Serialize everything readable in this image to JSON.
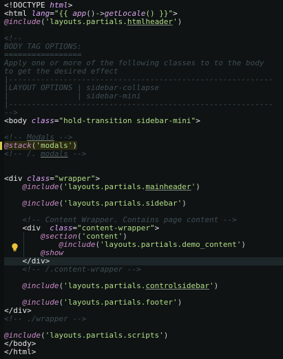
{
  "editor": {
    "language": "blade",
    "lines": [
      {
        "tokens": [
          [
            "<!DOCTYPE ",
            "tag"
          ],
          [
            "html",
            "attr"
          ],
          [
            ">",
            "tag"
          ]
        ]
      },
      {
        "tokens": [
          [
            "<",
            "tag"
          ],
          [
            "html ",
            "tag"
          ],
          [
            "lang",
            "attr"
          ],
          [
            "=",
            "eq"
          ],
          [
            "\"{{ ",
            "str"
          ],
          [
            "app",
            "fn"
          ],
          [
            "()->",
            "punc"
          ],
          [
            "getLocale",
            "fn"
          ],
          [
            "() }}\"",
            "str"
          ],
          [
            ">",
            "tag"
          ]
        ]
      },
      {
        "tokens": [
          [
            "@include",
            "kw"
          ],
          [
            "(",
            "punc"
          ],
          [
            "'layouts.partials.",
            "str"
          ],
          [
            "htmlheader",
            "str-u"
          ],
          [
            "'",
            "str"
          ],
          [
            ")",
            "punc"
          ]
        ]
      },
      {
        "tokens": []
      },
      {
        "tokens": [
          [
            "<!--",
            "cm"
          ]
        ]
      },
      {
        "tokens": [
          [
            "BODY TAG OPTIONS:",
            "cm"
          ]
        ]
      },
      {
        "tokens": [
          [
            "=================",
            "cm"
          ]
        ]
      },
      {
        "tokens": [
          [
            "Apply one or more of the following classes to to the body",
            "cm"
          ]
        ]
      },
      {
        "tokens": [
          [
            "to get the desired effect",
            "cm"
          ]
        ]
      },
      {
        "tokens": [
          [
            "|----------------------------------------------------------",
            "cm"
          ]
        ]
      },
      {
        "tokens": [
          [
            "|LAYOUT OPTIONS | sidebar-collapse",
            "cm"
          ]
        ]
      },
      {
        "tokens": [
          [
            "|               | sidebar-mini",
            "cm"
          ]
        ]
      },
      {
        "tokens": [
          [
            "|----------------------------------------------------------",
            "cm"
          ]
        ]
      },
      {
        "tokens": [
          [
            "-->",
            "cm"
          ]
        ]
      },
      {
        "tokens": [
          [
            "<",
            "tag"
          ],
          [
            "body ",
            "tag"
          ],
          [
            "class",
            "attr"
          ],
          [
            "=",
            "eq"
          ],
          [
            "\"hold-transition sidebar-mini\"",
            "str"
          ],
          [
            ">",
            "tag"
          ]
        ]
      },
      {
        "tokens": []
      },
      {
        "tokens": [
          [
            "<!-- ",
            "cm"
          ],
          [
            "Modals",
            "cm-u"
          ],
          [
            " -->",
            "cm"
          ]
        ]
      },
      {
        "tokens": [
          [
            "@stack",
            "kw"
          ],
          [
            "(",
            "punc"
          ],
          [
            "'modals'",
            "str"
          ],
          [
            ")",
            "punc"
          ]
        ]
      },
      {
        "tokens": [
          [
            "<!-- /. ",
            "cm"
          ],
          [
            "modals",
            "cm-u"
          ],
          [
            " -->",
            "cm"
          ]
        ]
      },
      {
        "tokens": []
      },
      {
        "tokens": []
      },
      {
        "tokens": [
          [
            "<",
            "tag"
          ],
          [
            "div ",
            "tag"
          ],
          [
            "class",
            "attr"
          ],
          [
            "=",
            "eq"
          ],
          [
            "\"wrapper\"",
            "str"
          ],
          [
            ">",
            "tag"
          ]
        ]
      },
      {
        "tokens": [
          [
            "    ",
            "punc"
          ],
          [
            "@include",
            "kw"
          ],
          [
            "(",
            "punc"
          ],
          [
            "'layouts.partials.",
            "str"
          ],
          [
            "mainheader",
            "str-u"
          ],
          [
            "'",
            "str"
          ],
          [
            ")",
            "punc"
          ]
        ]
      },
      {
        "tokens": []
      },
      {
        "tokens": [
          [
            "    ",
            "punc"
          ],
          [
            "@include",
            "kw"
          ],
          [
            "(",
            "punc"
          ],
          [
            "'layouts.partials.sidebar'",
            "str"
          ],
          [
            ")",
            "punc"
          ]
        ]
      },
      {
        "tokens": []
      },
      {
        "tokens": [
          [
            "    ",
            "punc"
          ],
          [
            "<!-- Content Wrapper. Contains page content -->",
            "cm"
          ]
        ]
      },
      {
        "tokens": [
          [
            "    ",
            "punc"
          ],
          [
            "<",
            "tag"
          ],
          [
            "div",
            "tag"
          ],
          [
            "  ",
            "punc"
          ],
          [
            "class",
            "attr"
          ],
          [
            "=",
            "eq"
          ],
          [
            "\"content-wrapper\"",
            "str"
          ],
          [
            ">",
            "tag"
          ]
        ]
      },
      {
        "tokens": [
          [
            "        ",
            "punc"
          ],
          [
            "@section",
            "kw"
          ],
          [
            "(",
            "punc"
          ],
          [
            "'content'",
            "str"
          ],
          [
            ")",
            "punc"
          ]
        ]
      },
      {
        "tokens": [
          [
            "            ",
            "punc"
          ],
          [
            "@include",
            "kw"
          ],
          [
            "(",
            "punc"
          ],
          [
            "'layouts.partials.demo_content'",
            "str"
          ],
          [
            ")",
            "punc"
          ]
        ]
      },
      {
        "tokens": [
          [
            "        ",
            "punc"
          ],
          [
            "@show",
            "kw"
          ]
        ]
      },
      {
        "tokens": [
          [
            "    ",
            "punc"
          ],
          [
            "</",
            "tag"
          ],
          [
            "div",
            "tag"
          ],
          [
            ">",
            "tag"
          ]
        ]
      },
      {
        "tokens": [
          [
            "    ",
            "punc"
          ],
          [
            "<!-- /.content-wrapper -->",
            "cm"
          ]
        ]
      },
      {
        "tokens": []
      },
      {
        "tokens": [
          [
            "    ",
            "punc"
          ],
          [
            "@include",
            "kw"
          ],
          [
            "(",
            "punc"
          ],
          [
            "'layouts.partials.",
            "str"
          ],
          [
            "controlsidebar",
            "str-u"
          ],
          [
            "'",
            "str"
          ],
          [
            ")",
            "punc"
          ]
        ]
      },
      {
        "tokens": []
      },
      {
        "tokens": [
          [
            "    ",
            "punc"
          ],
          [
            "@include",
            "kw"
          ],
          [
            "(",
            "punc"
          ],
          [
            "'layouts.partials.footer'",
            "str"
          ],
          [
            ")",
            "punc"
          ]
        ]
      },
      {
        "tokens": [
          [
            "</",
            "tag"
          ],
          [
            "div",
            "tag"
          ],
          [
            ">",
            "tag"
          ]
        ]
      },
      {
        "tokens": [
          [
            "<!-- ./wrapper -->",
            "cm"
          ]
        ]
      },
      {
        "tokens": []
      },
      {
        "tokens": [
          [
            "@include",
            "kw"
          ],
          [
            "(",
            "punc"
          ],
          [
            "'layouts.partials.scripts'",
            "str"
          ],
          [
            ")",
            "punc"
          ]
        ]
      },
      {
        "tokens": [
          [
            "</",
            "tag"
          ],
          [
            "body",
            "tag"
          ],
          [
            ">",
            "tag"
          ]
        ]
      },
      {
        "tokens": [
          [
            "</",
            "tag"
          ],
          [
            "html",
            "tag"
          ],
          [
            ">",
            "tag"
          ]
        ]
      }
    ],
    "active_line": 31,
    "highlighted_line": 17
  },
  "icons": {
    "lightbulb": "lightbulb-icon"
  },
  "colors": {
    "background": "#0f1314",
    "comment": "#3f4d54",
    "keyword": "#cc8bc7",
    "string": "#b2dd86",
    "attribute": "#e3a6ff",
    "tag": "#e8e8e8",
    "active_line": "#1d2628",
    "lightbulb": "#e8c33a"
  }
}
